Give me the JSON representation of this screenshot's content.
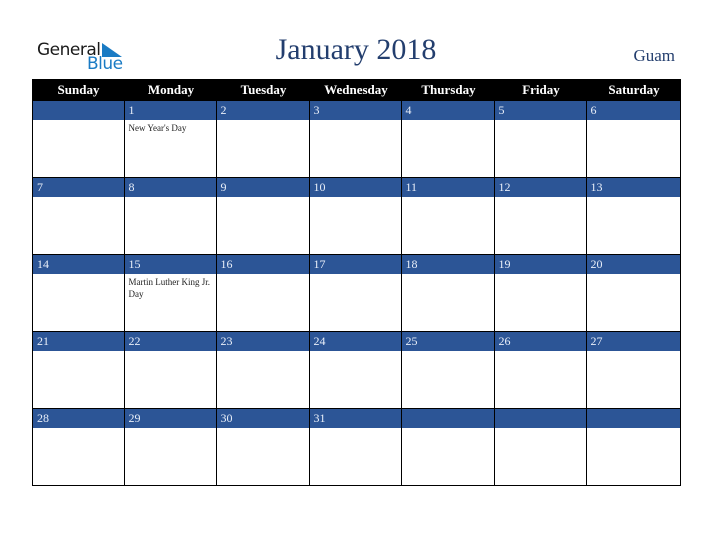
{
  "logo": {
    "line1": "General",
    "line2": "Blue"
  },
  "title": "January 2018",
  "region": "Guam",
  "colors": {
    "title": "#233e6e",
    "band": "#2c5596",
    "header_bg": "#000000",
    "logo_blue": "#1a7bc4"
  },
  "weekdays": [
    "Sunday",
    "Monday",
    "Tuesday",
    "Wednesday",
    "Thursday",
    "Friday",
    "Saturday"
  ],
  "weeks": [
    [
      {
        "day": "",
        "event": ""
      },
      {
        "day": "1",
        "event": "New Year's Day"
      },
      {
        "day": "2",
        "event": ""
      },
      {
        "day": "3",
        "event": ""
      },
      {
        "day": "4",
        "event": ""
      },
      {
        "day": "5",
        "event": ""
      },
      {
        "day": "6",
        "event": ""
      }
    ],
    [
      {
        "day": "7",
        "event": ""
      },
      {
        "day": "8",
        "event": ""
      },
      {
        "day": "9",
        "event": ""
      },
      {
        "day": "10",
        "event": ""
      },
      {
        "day": "11",
        "event": ""
      },
      {
        "day": "12",
        "event": ""
      },
      {
        "day": "13",
        "event": ""
      }
    ],
    [
      {
        "day": "14",
        "event": ""
      },
      {
        "day": "15",
        "event": "Martin Luther King Jr. Day"
      },
      {
        "day": "16",
        "event": ""
      },
      {
        "day": "17",
        "event": ""
      },
      {
        "day": "18",
        "event": ""
      },
      {
        "day": "19",
        "event": ""
      },
      {
        "day": "20",
        "event": ""
      }
    ],
    [
      {
        "day": "21",
        "event": ""
      },
      {
        "day": "22",
        "event": ""
      },
      {
        "day": "23",
        "event": ""
      },
      {
        "day": "24",
        "event": ""
      },
      {
        "day": "25",
        "event": ""
      },
      {
        "day": "26",
        "event": ""
      },
      {
        "day": "27",
        "event": ""
      }
    ],
    [
      {
        "day": "28",
        "event": ""
      },
      {
        "day": "29",
        "event": ""
      },
      {
        "day": "30",
        "event": ""
      },
      {
        "day": "31",
        "event": ""
      },
      {
        "day": "",
        "event": ""
      },
      {
        "day": "",
        "event": ""
      },
      {
        "day": "",
        "event": ""
      }
    ]
  ]
}
